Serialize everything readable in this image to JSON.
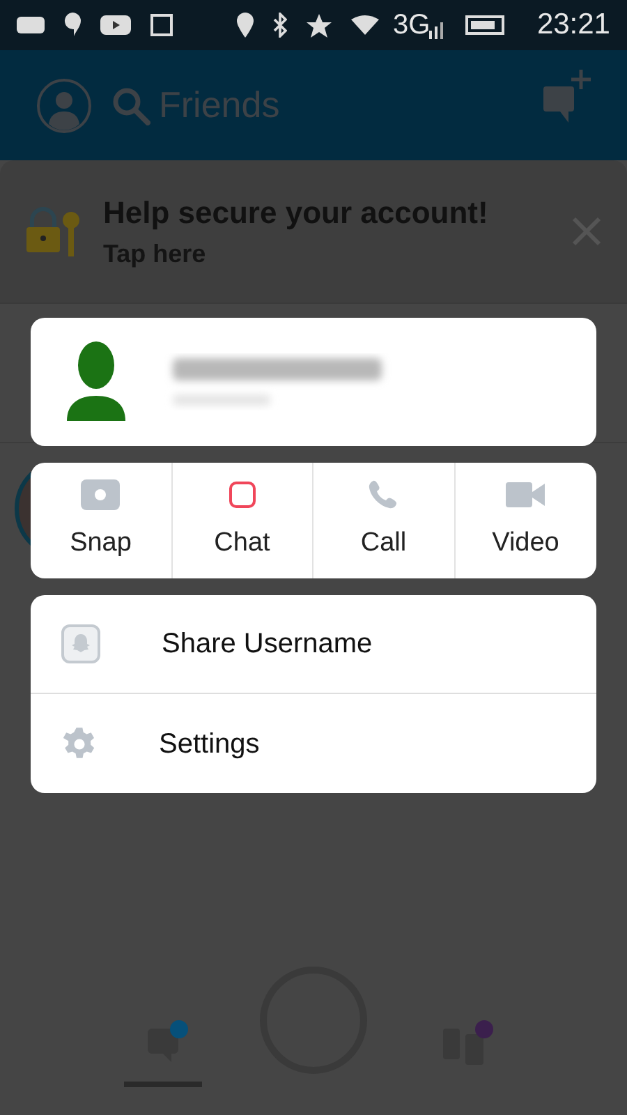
{
  "status_bar": {
    "network": "3G",
    "time": "23:21"
  },
  "header": {
    "search_label": "Friends"
  },
  "banner": {
    "title": "Help secure your account!",
    "subtitle": "Tap here"
  },
  "actions": [
    {
      "kind": "snap",
      "label": "Snap"
    },
    {
      "kind": "chat",
      "label": "Chat"
    },
    {
      "kind": "call",
      "label": "Call"
    },
    {
      "kind": "video",
      "label": "Video"
    }
  ],
  "menu": [
    {
      "kind": "share",
      "label": "Share Username"
    },
    {
      "kind": "settings",
      "label": "Settings"
    }
  ],
  "bottom_nav": [
    {
      "kind": "chat",
      "selected": true,
      "color": "#06507a"
    },
    {
      "kind": "stories",
      "selected": false,
      "color": "#3b1f4d"
    }
  ]
}
